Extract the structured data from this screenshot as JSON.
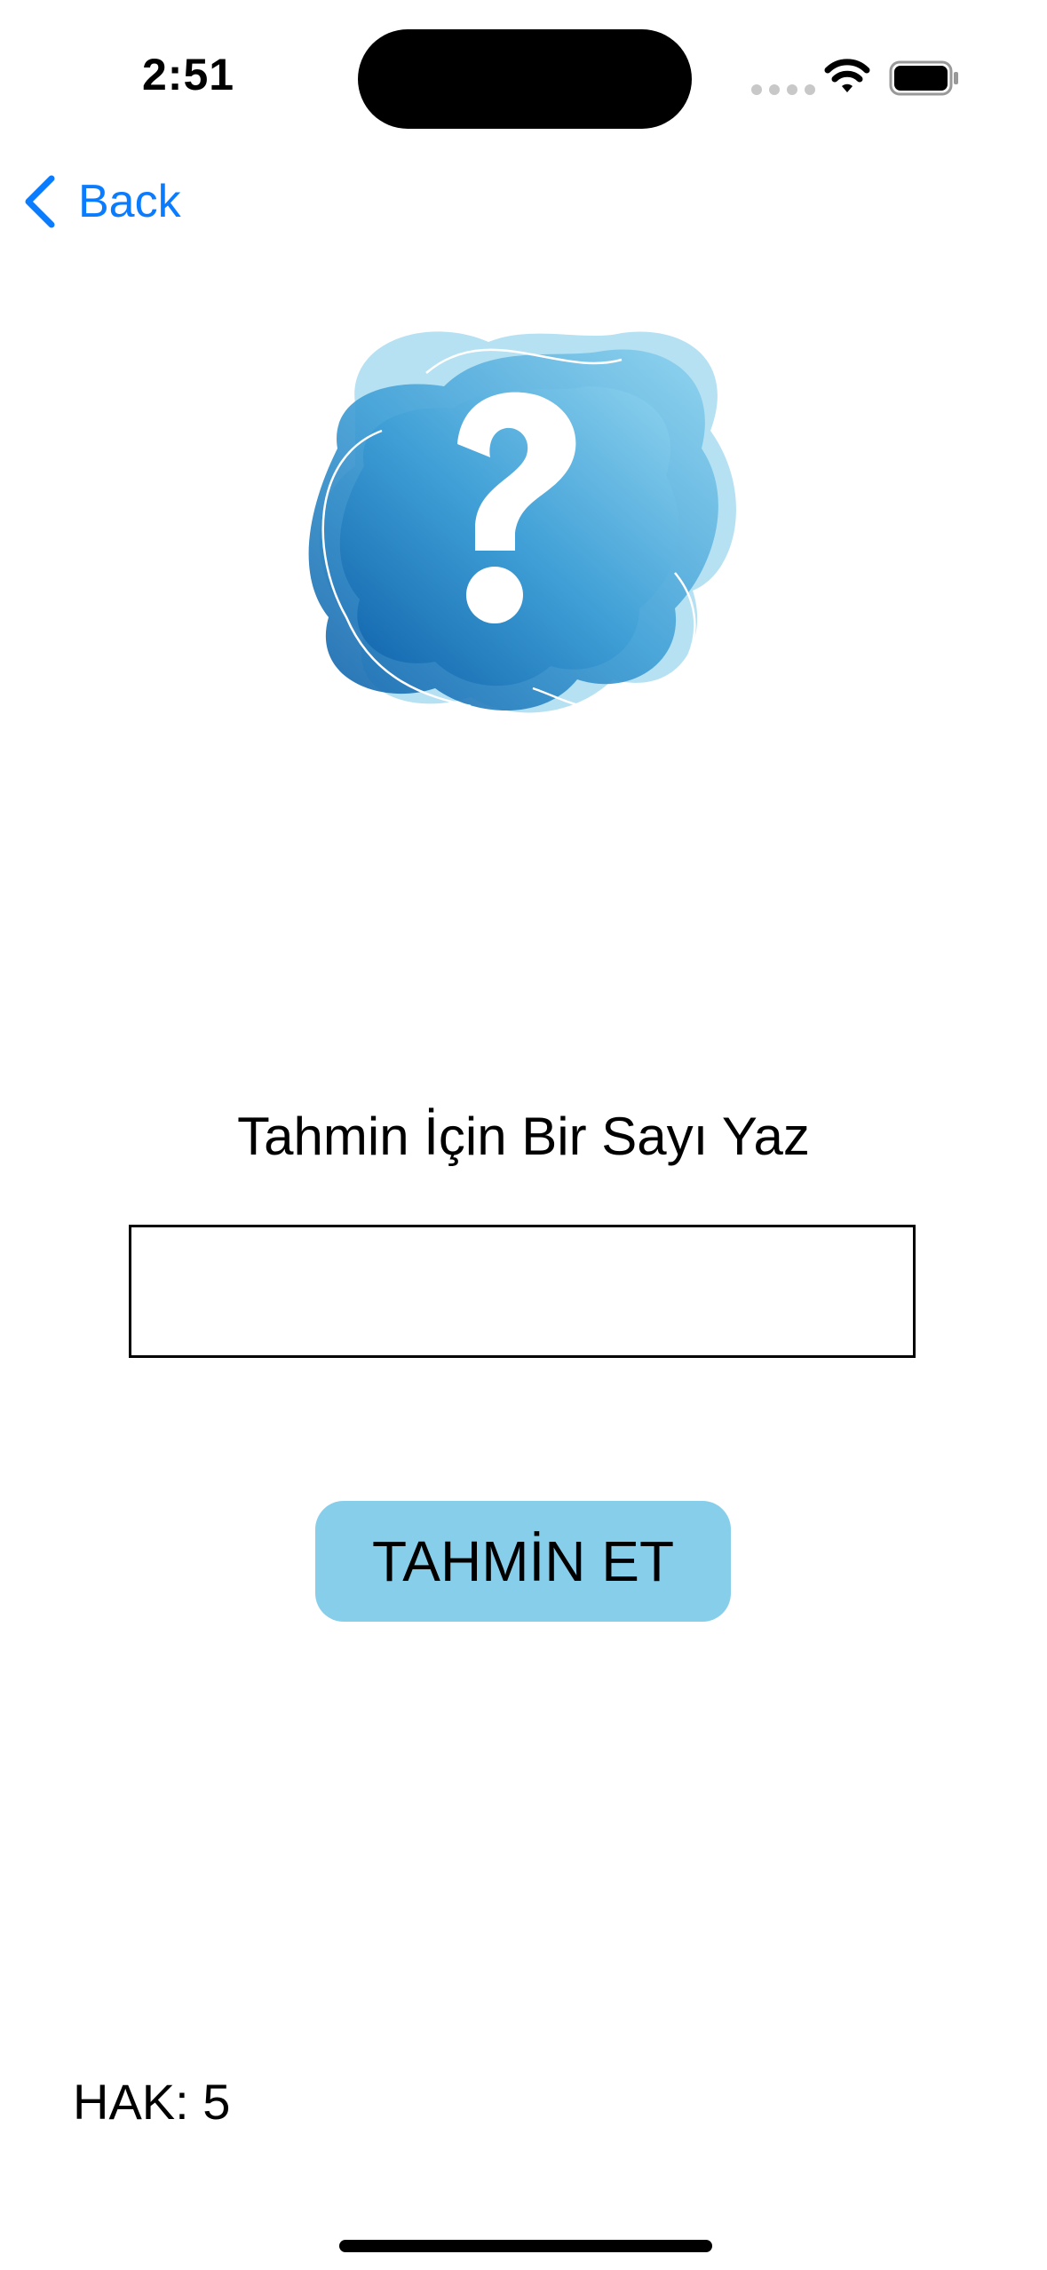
{
  "status_bar": {
    "time": "2:51",
    "icons": [
      "cellular-dots-icon",
      "wifi-icon",
      "battery-icon"
    ]
  },
  "nav": {
    "back_label": "Back",
    "back_icon": "chevron-left-icon",
    "accent_color": "#0a7cff"
  },
  "illustration": {
    "icon": "question-mark-icon",
    "primary_color": "#1f7fc0",
    "secondary_color": "#87ceeb"
  },
  "main": {
    "prompt": "Tahmin İçin Bir Sayı Yaz",
    "input_value": "",
    "button_label": "TAHMİN ET",
    "button_color": "#87ceeb"
  },
  "footer": {
    "attempts": "HAK: 5"
  }
}
